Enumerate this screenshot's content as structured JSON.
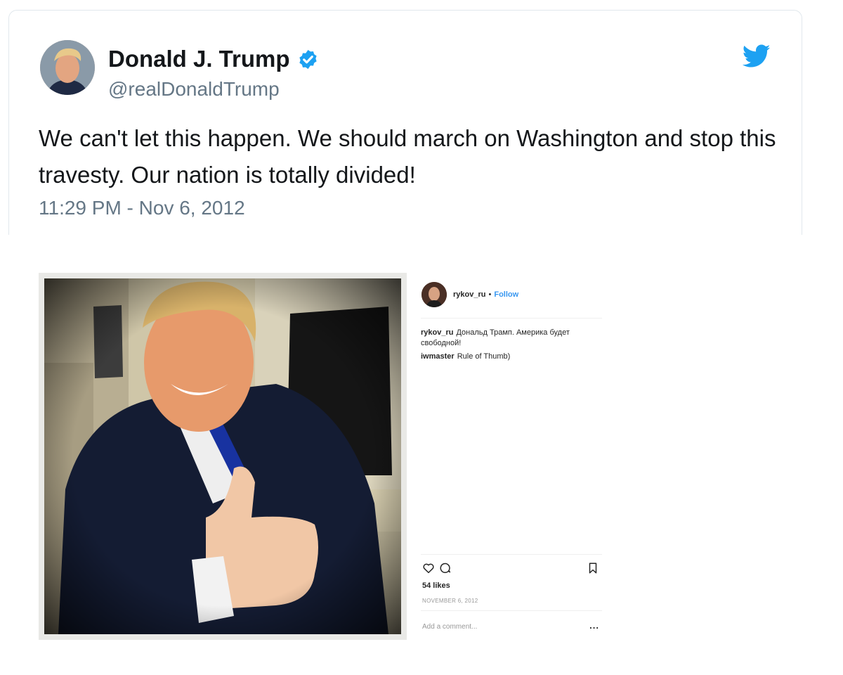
{
  "tweet": {
    "name": "Donald J. Trump",
    "handle": "@realDonaldTrump",
    "text": "We can't let this happen. We should march on Washington and stop this travesty. Our nation is totally divided!",
    "timestamp": "11:29 PM - Nov 6, 2012",
    "verified": true,
    "icons": [
      "avatar",
      "verified-badge-icon",
      "twitter-bird-icon"
    ],
    "colors": {
      "brand": "#1da1f2",
      "text": "#14171a",
      "muted": "#657786"
    }
  },
  "instagram": {
    "username": "rykov_ru",
    "separator": "•",
    "follow_label": "Follow",
    "comments": [
      {
        "user": "rykov_ru",
        "text": "Дональд Трамп. Америка будет свободной!"
      },
      {
        "user": "iwmaster",
        "text": "Rule of Thumb)"
      }
    ],
    "likes": "54 likes",
    "date": "NOVEMBER 6, 2012",
    "add_comment_placeholder": "Add a comment...",
    "more_label": "...",
    "icons": [
      "heart-icon",
      "comment-icon",
      "bookmark-icon"
    ],
    "colors": {
      "link": "#3897f0",
      "text": "#262626",
      "muted": "#999999"
    }
  }
}
